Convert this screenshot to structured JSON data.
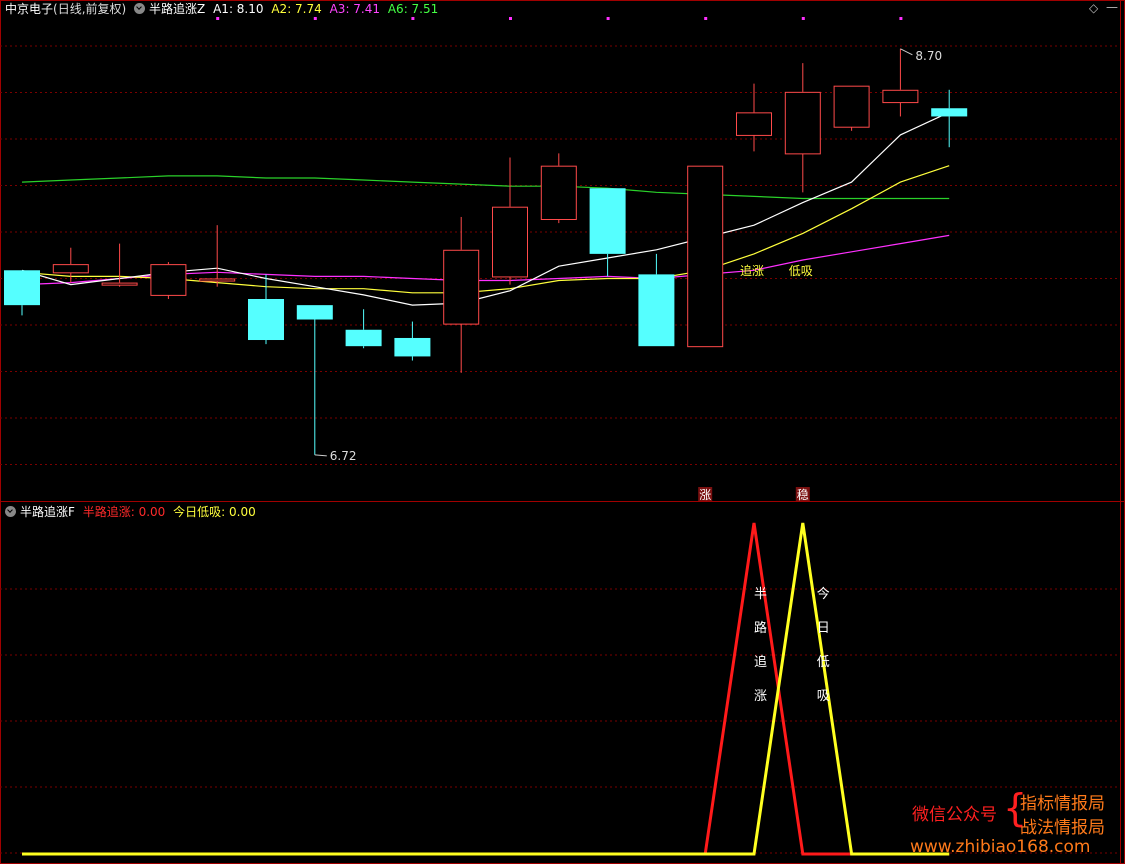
{
  "top_header": {
    "stock": "中京电子",
    "period": "(日线,前复权)",
    "indicator": "半路追涨Z",
    "a1": "A1: 8.10",
    "a2": "A2: 7.74",
    "a3": "A3: 7.41",
    "a6": "A6: 7.51"
  },
  "bottom_header": {
    "indicator": "半路追涨F",
    "v1": "半路追涨: 0.00",
    "v2": "今日低吸: 0.00"
  },
  "watermark": {
    "wechat": "微信公众号",
    "line1": "指标情报局",
    "line2": "战法情报局",
    "url": "www.zhibiao168.com"
  },
  "window_buttons": {
    "diamond": "◇",
    "min": "—"
  },
  "colors": {
    "background": "#000000",
    "grid": "#7a0000",
    "border": "#a00000",
    "up_candle": "#ff4a4a",
    "down_candle": "#55ffff",
    "ma_white": "#ffffff",
    "ma_yellow": "#ffff3c",
    "ma_magenta": "#ff30ff",
    "ma_green": "#2ad12a",
    "red_signal": "#ff1a1a",
    "yellow_signal": "#ffff20",
    "header_a1": "#ffffff",
    "header_a2": "#ffff3c",
    "header_a3": "#ff44ff",
    "header_a6": "#44ff44"
  },
  "chart_data": [
    {
      "type": "candlestick",
      "ylim": [
        6.5,
        8.85
      ],
      "candles": [
        {
          "o": 7.62,
          "h": 7.62,
          "l": 7.4,
          "c": 7.45
        },
        {
          "o": 7.61,
          "h": 7.73,
          "l": 7.56,
          "c": 7.65
        },
        {
          "o": 7.55,
          "h": 7.75,
          "l": 7.54,
          "c": 7.56
        },
        {
          "o": 7.5,
          "h": 7.66,
          "l": 7.48,
          "c": 7.65
        },
        {
          "o": 7.57,
          "h": 7.84,
          "l": 7.54,
          "c": 7.58
        },
        {
          "o": 7.48,
          "h": 7.6,
          "l": 7.26,
          "c": 7.28
        },
        {
          "o": 7.45,
          "h": 7.45,
          "l": 6.72,
          "c": 7.38
        },
        {
          "o": 7.33,
          "h": 7.43,
          "l": 7.24,
          "c": 7.25
        },
        {
          "o": 7.29,
          "h": 7.37,
          "l": 7.18,
          "c": 7.2
        },
        {
          "o": 7.36,
          "h": 7.88,
          "l": 7.12,
          "c": 7.72
        },
        {
          "o": 7.59,
          "h": 8.17,
          "l": 7.55,
          "c": 7.93
        },
        {
          "o": 7.87,
          "h": 8.19,
          "l": 7.85,
          "c": 8.13
        },
        {
          "o": 8.02,
          "h": 8.02,
          "l": 7.59,
          "c": 7.7
        },
        {
          "o": 7.6,
          "h": 7.7,
          "l": 7.25,
          "c": 7.25
        },
        {
          "o": 7.25,
          "h": 8.13,
          "l": 7.25,
          "c": 8.13
        },
        {
          "o": 8.28,
          "h": 8.53,
          "l": 8.2,
          "c": 8.39
        },
        {
          "o": 8.19,
          "h": 8.63,
          "l": 8.0,
          "c": 8.49
        },
        {
          "o": 8.32,
          "h": 8.52,
          "l": 8.3,
          "c": 8.52
        },
        {
          "o": 8.44,
          "h": 8.7,
          "l": 8.37,
          "c": 8.5
        },
        {
          "o": 8.41,
          "h": 8.5,
          "l": 8.22,
          "c": 8.37
        }
      ],
      "ma_white": [
        7.62,
        7.55,
        7.58,
        7.61,
        7.63,
        7.58,
        7.54,
        7.5,
        7.45,
        7.46,
        7.52,
        7.64,
        7.68,
        7.72,
        7.78,
        7.84,
        7.95,
        8.05,
        8.28,
        8.39
      ],
      "ma_yellow": [
        7.61,
        7.59,
        7.59,
        7.58,
        7.56,
        7.54,
        7.53,
        7.53,
        7.51,
        7.51,
        7.53,
        7.57,
        7.58,
        7.58,
        7.62,
        7.7,
        7.8,
        7.92,
        8.05,
        8.13
      ],
      "ma_magenta": [
        7.55,
        7.56,
        7.58,
        7.6,
        7.61,
        7.6,
        7.59,
        7.59,
        7.58,
        7.57,
        7.57,
        7.58,
        7.59,
        7.58,
        7.6,
        7.62,
        7.67,
        7.71,
        7.75,
        7.79
      ],
      "ma_green": [
        8.05,
        8.06,
        8.07,
        8.08,
        8.08,
        8.07,
        8.07,
        8.06,
        8.05,
        8.04,
        8.03,
        8.03,
        8.02,
        8.0,
        7.99,
        7.98,
        7.97,
        7.97,
        7.97,
        7.97
      ],
      "annotations": [
        {
          "text": "6.72",
          "index": 6,
          "value": 6.72,
          "kind": "low"
        },
        {
          "text": "8.70",
          "index": 18,
          "value": 8.7,
          "kind": "high"
        },
        {
          "text": "追涨",
          "index": 15,
          "color": "#ffff3c"
        },
        {
          "text": "低吸",
          "index": 16,
          "color": "#ffff3c"
        }
      ],
      "badges": [
        {
          "text": "涨",
          "index": 14
        },
        {
          "text": "稳",
          "index": 16
        }
      ]
    },
    {
      "type": "line",
      "ylim": [
        0,
        1
      ],
      "series": [
        {
          "name": "半路追涨",
          "color": "red_signal",
          "values": [
            0,
            0,
            0,
            0,
            0,
            0,
            0,
            0,
            0,
            0,
            0,
            0,
            0,
            0,
            0,
            1,
            0,
            0,
            0,
            0
          ]
        },
        {
          "name": "今日低吸",
          "color": "yellow_signal",
          "values": [
            0,
            0,
            0,
            0,
            0,
            0,
            0,
            0,
            0,
            0,
            0,
            0,
            0,
            0,
            0,
            0,
            1,
            0,
            0,
            0
          ]
        }
      ],
      "vertical_labels": [
        {
          "chars": [
            "半",
            "路",
            "追",
            "涨"
          ],
          "index": 15
        },
        {
          "chars": [
            "今",
            "日",
            "低",
            "吸"
          ],
          "index": 16
        }
      ]
    }
  ]
}
